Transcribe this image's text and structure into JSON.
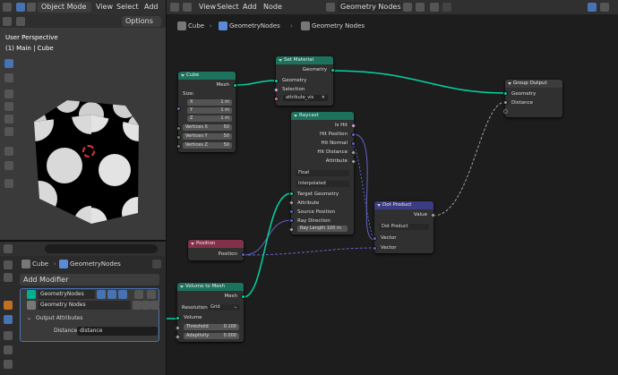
{
  "viewport": {
    "mode_label": "Object Mode",
    "menu": [
      "View",
      "Select",
      "Add"
    ],
    "options_label": "Options",
    "title": "User Perspective",
    "subtitle": "(1) Main | Cube"
  },
  "editor": {
    "menu": [
      "View",
      "Select",
      "Add",
      "Node"
    ],
    "tree_name": "Geometry Nodes",
    "breadcrumbs": [
      "Cube",
      "GeometryNodes",
      "Geometry Nodes"
    ]
  },
  "properties": {
    "breadcrumbs": [
      "Cube",
      "GeometryNodes"
    ],
    "add_modifier": "Add Modifier",
    "modifier_name": "GeometryNodes",
    "node_group": "Geometry Nodes",
    "output_attributes": "Output Attributes",
    "distance_label": "Distance",
    "distance_value": "distance"
  },
  "nodes": {
    "cube": {
      "title": "Cube",
      "mesh": "Mesh",
      "size": "Size:",
      "x": "X",
      "x_val": "1 m",
      "y": "Y",
      "y_val": "1 m",
      "z": "Z",
      "z_val": "1 m",
      "vx": "Vertices X",
      "vx_val": "50",
      "vy": "Vertices Y",
      "vy_val": "50",
      "vz": "Vertices Z",
      "vz_val": "50"
    },
    "set_material": {
      "title": "Set Material",
      "geo_out": "Geometry",
      "geo_in": "Geometry",
      "selection": "Selection",
      "material": "attribute_vis"
    },
    "group_output": {
      "title": "Group Output",
      "geometry": "Geometry",
      "distance": "Distance"
    },
    "raycast": {
      "title": "Raycast",
      "is_hit": "Is Hit",
      "hit_position": "Hit Position",
      "hit_normal": "Hit Normal",
      "hit_distance": "Hit Distance",
      "attribute_out": "Attribute",
      "type": "Float",
      "mode": "Interpolated",
      "target_geometry": "Target Geometry",
      "attribute_in": "Attribute",
      "source_position": "Source Position",
      "ray_direction": "Ray Direction",
      "ray_length": "Ray Length",
      "ray_length_val": "100 m"
    },
    "dot_product": {
      "title": "Dot Product",
      "value": "Value",
      "op": "Dot Product",
      "vector1": "Vector",
      "vector2": "Vector"
    },
    "position": {
      "title": "Position",
      "position": "Position"
    },
    "volume_to_mesh": {
      "title": "Volume to Mesh",
      "mesh": "Mesh",
      "resolution": "Resolution",
      "resolution_val": "Grid",
      "volume": "Volume",
      "threshold": "Threshold",
      "threshold_val": "0.100",
      "adaptivity": "Adaptivity",
      "adaptivity_val": "0.000"
    }
  },
  "colors": {
    "geometry": "#00d6a3",
    "vector": "#6363c7",
    "float": "#a1a1a1",
    "bool": "#cca6d6",
    "input_node": "#83314a",
    "geometry_node": "#1d725e",
    "vector_node": "#3c3c83",
    "output_node": "#3c3c3c"
  }
}
